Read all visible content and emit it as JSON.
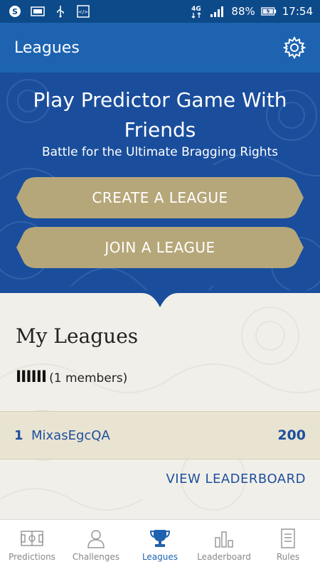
{
  "status_bar": {
    "network": "4G",
    "battery": "88%",
    "time": "17:54",
    "icons": [
      "skype-icon",
      "image-icon",
      "usb-icon",
      "code-icon",
      "network-icon",
      "signal-icon",
      "battery-icon"
    ]
  },
  "header": {
    "title": "Leagues",
    "settings_icon": "gear-icon"
  },
  "hero": {
    "title": "Play Predictor Game With Friends",
    "subtitle": "Battle for the Ultimate Bragging Rights",
    "create_label": "CREATE A LEAGUE",
    "join_label": "JOIN A LEAGUE"
  },
  "my_leagues": {
    "heading": "My Leagues",
    "league_name": "IIIIII",
    "members": "(1 members)",
    "rows": [
      {
        "rank": "1",
        "name": "MixasEgcQA",
        "score": "200"
      }
    ],
    "view_label": "VIEW LEADERBOARD"
  },
  "bottom_nav": {
    "items": [
      {
        "label": "Predictions",
        "icon": "pitch-icon"
      },
      {
        "label": "Challenges",
        "icon": "user-icon"
      },
      {
        "label": "Leagues",
        "icon": "trophy-icon"
      },
      {
        "label": "Leaderboard",
        "icon": "bar-chart-icon"
      },
      {
        "label": "Rules",
        "icon": "document-icon"
      }
    ],
    "active": "Leagues"
  },
  "colors": {
    "primary": "#1d63b0",
    "hero": "#1a4e9c",
    "gold": "#b6a77a",
    "accent_text": "#1d4f9c"
  }
}
